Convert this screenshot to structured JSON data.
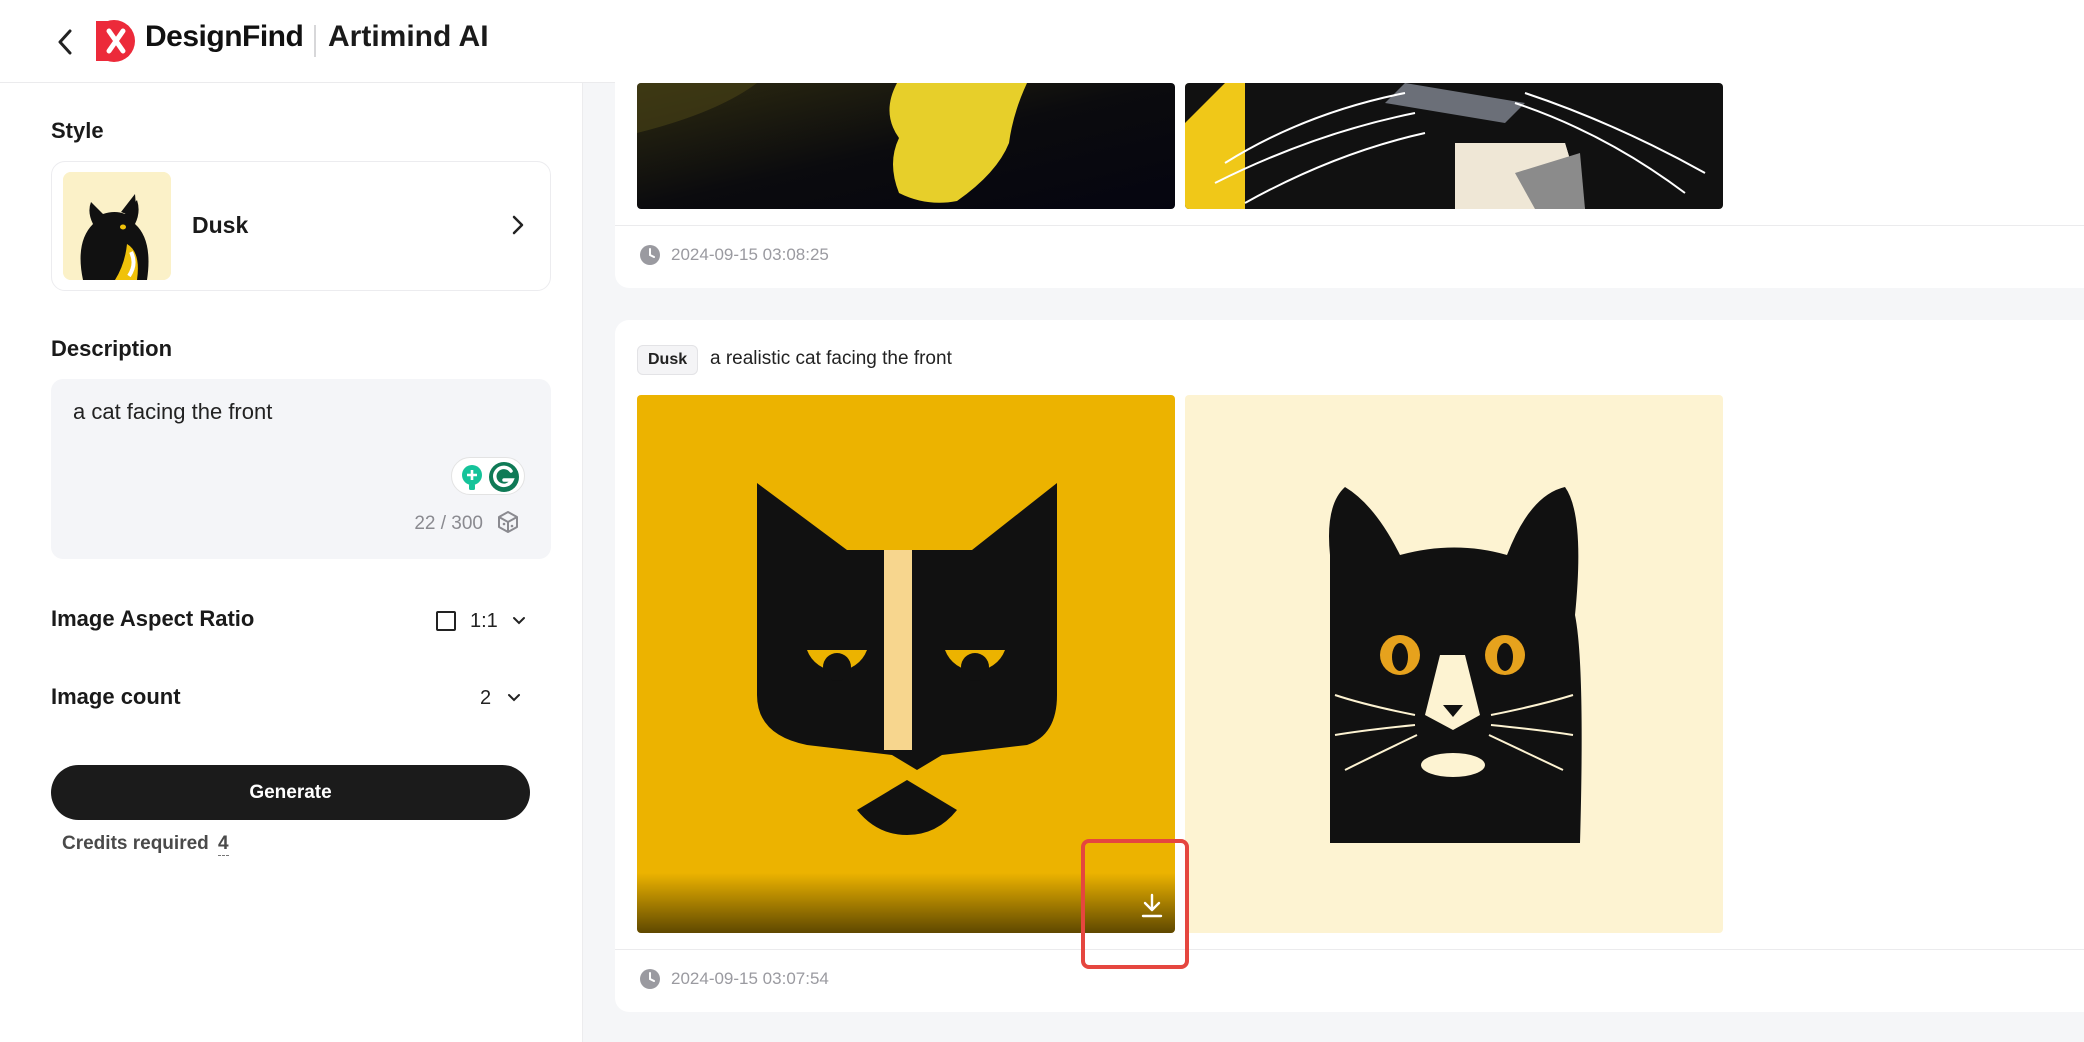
{
  "header": {
    "brand": "DesignFind",
    "app_name": "Artimind AI",
    "brand_color": "#ec2a3a"
  },
  "sidebar": {
    "style_title": "Style",
    "style_selected": "Dusk",
    "description_title": "Description",
    "description_text": "a cat facing the front",
    "description_counter": "22 / 300",
    "aspect_ratio_label": "Image Aspect Ratio",
    "aspect_ratio_value": "1:1",
    "image_count_label": "Image count",
    "image_count_value": "2",
    "generate_label": "Generate",
    "credits_label": "Credits required",
    "credits_value": "4"
  },
  "results": [
    {
      "timestamp": "2024-09-15 03:08:25"
    },
    {
      "style_tag": "Dusk",
      "prompt": "a realistic cat facing the front",
      "timestamp": "2024-09-15 03:07:54"
    }
  ],
  "icons": {
    "back": "chevron-left-icon",
    "style_next": "chevron-right-icon",
    "dropdown": "chevron-down-icon",
    "download": "download-icon",
    "clock": "clock-icon",
    "dice": "dice-icon"
  },
  "colors": {
    "generate_bg": "#1b1b1b",
    "highlight": "#e5463f",
    "yellow_cat_bg": "#ecb300",
    "cream_cat_bg": "#fdf3d2"
  }
}
